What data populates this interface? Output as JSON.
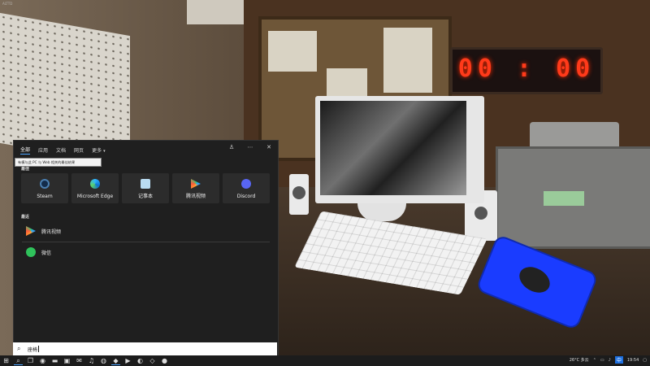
{
  "watermark": "ALTTD",
  "clock_display": "00 : 00",
  "panel": {
    "tabs": [
      {
        "label": "全部",
        "active": true
      },
      {
        "label": "应用"
      },
      {
        "label": "文档"
      },
      {
        "label": "网页"
      },
      {
        "label": "更多"
      }
    ],
    "tooltip": "有模与此 PC 与 Web 相关的最佳结果",
    "pinned_label": "最佳",
    "apps": [
      {
        "label": "Steam",
        "icon": "steam-icon"
      },
      {
        "label": "Microsoft Edge",
        "icon": "edge-icon"
      },
      {
        "label": "记事本",
        "icon": "notepad-icon"
      },
      {
        "label": "腾讯视频",
        "icon": "tencent-video-icon"
      },
      {
        "label": "Discord",
        "icon": "discord-icon"
      }
    ],
    "recent_label": "最近",
    "recent": [
      {
        "label": "腾讯视频",
        "icon": "tencent-video-icon"
      },
      {
        "label": "微信",
        "icon": "wechat-icon"
      }
    ]
  },
  "search": {
    "query": "座椅"
  },
  "taskbar": {
    "tray_weather": "26°C 多云",
    "tray_ime": "中",
    "tray_time": "19:54"
  },
  "colors": {
    "accent": "#4aa3ff",
    "panel_bg": "#1f1f1f",
    "clock_red": "#ff3a1a",
    "mousepad_blue": "#1a3cff"
  }
}
